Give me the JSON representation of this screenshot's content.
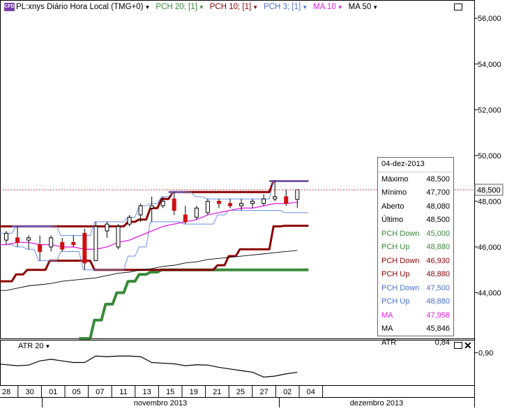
{
  "header": {
    "badge": "CFD",
    "symbol": "PL:xnys Diário Hora Local (TMG+0)",
    "indicators": [
      {
        "label": "PCH 20; [1]",
        "color": "#3a8a3a"
      },
      {
        "label": "PCH 10; [1]",
        "color": "#8b0000"
      },
      {
        "label": "PCH 3; [1]",
        "color": "#4a6fd0"
      },
      {
        "label": "MA 10",
        "color": "#e020e0"
      },
      {
        "label": "MA 50",
        "color": "#000000"
      }
    ]
  },
  "price_axis": {
    "ticks": [
      "56,000",
      "54,000",
      "52,000",
      "50,000",
      "48,000",
      "46,000",
      "44,000"
    ],
    "current_price": "48,500"
  },
  "atr_axis": {
    "ticks": [
      "0,90"
    ]
  },
  "x_axis": {
    "days": [
      "28",
      "30",
      "01",
      "05",
      "07",
      "11",
      "13",
      "15",
      "19",
      "21",
      "25",
      "27",
      "02",
      "04"
    ],
    "months": [
      "novembro 2013",
      "dezembro 2013"
    ]
  },
  "info_box": {
    "date": "04-dez-2013",
    "rows": [
      {
        "label": "Máximo",
        "value": "48,500",
        "color": "#000000"
      },
      {
        "label": "Mínimo",
        "value": "47,700",
        "color": "#000000"
      },
      {
        "label": "Aberto",
        "value": "48,080",
        "color": "#000000"
      },
      {
        "label": "Último",
        "value": "48,500",
        "color": "#000000"
      },
      {
        "label": "PCH Down",
        "value": "45,000",
        "color": "#3a8a3a"
      },
      {
        "label": "PCH Up",
        "value": "48,880",
        "color": "#3a8a3a"
      },
      {
        "label": "PCH Down",
        "value": "46,930",
        "color": "#8b0000"
      },
      {
        "label": "PCH Up",
        "value": "48,880",
        "color": "#8b0000"
      },
      {
        "label": "PCH Down",
        "value": "47,500",
        "color": "#4a6fd0"
      },
      {
        "label": "PCH Up",
        "value": "48,880",
        "color": "#4a6fd0"
      },
      {
        "label": "MA",
        "value": "47,958",
        "color": "#e020e0"
      },
      {
        "label": "MA",
        "value": "45,846",
        "color": "#000000"
      },
      {
        "label": "ATR",
        "value": "0,84",
        "color": "#000000"
      }
    ]
  },
  "atr_panel": {
    "label": "ATR 20"
  },
  "chart_data": {
    "type": "line",
    "title": "PL:xnys Diário Hora Local (TMG+0)",
    "ylim": [
      42.0,
      56.8
    ],
    "atr_ylim": [
      0.8,
      0.94
    ],
    "candles": [
      {
        "o": 46.3,
        "h": 46.7,
        "l": 46.1,
        "c": 46.6
      },
      {
        "o": 46.4,
        "h": 46.9,
        "l": 46.0,
        "c": 46.2
      },
      {
        "o": 46.3,
        "h": 46.5,
        "l": 45.9,
        "c": 46.4
      },
      {
        "o": 46.1,
        "h": 46.5,
        "l": 45.4,
        "c": 45.8
      },
      {
        "o": 46.0,
        "h": 46.5,
        "l": 45.8,
        "c": 46.4
      },
      {
        "o": 46.2,
        "h": 46.4,
        "l": 45.8,
        "c": 45.9
      },
      {
        "o": 46.2,
        "h": 46.5,
        "l": 46.0,
        "c": 46.1
      },
      {
        "o": 46.6,
        "h": 46.8,
        "l": 45.0,
        "c": 45.3
      },
      {
        "o": 45.4,
        "h": 47.1,
        "l": 45.4,
        "c": 46.9
      },
      {
        "o": 46.7,
        "h": 47.1,
        "l": 46.4,
        "c": 47.0
      },
      {
        "o": 46.0,
        "h": 47.0,
        "l": 45.9,
        "c": 46.9
      },
      {
        "o": 47.0,
        "h": 47.4,
        "l": 46.9,
        "c": 47.3
      },
      {
        "o": 47.4,
        "h": 47.9,
        "l": 47.1,
        "c": 47.8
      },
      {
        "o": 47.7,
        "h": 48.2,
        "l": 47.1,
        "c": 47.8
      },
      {
        "o": 47.8,
        "h": 48.2,
        "l": 47.7,
        "c": 48.0
      },
      {
        "o": 48.1,
        "h": 48.4,
        "l": 47.4,
        "c": 47.6
      },
      {
        "o": 47.4,
        "h": 47.8,
        "l": 47.0,
        "c": 47.1
      },
      {
        "o": 47.3,
        "h": 47.8,
        "l": 47.2,
        "c": 47.7
      },
      {
        "o": 47.5,
        "h": 48.1,
        "l": 47.4,
        "c": 48.0
      },
      {
        "o": 48.0,
        "h": 48.1,
        "l": 47.7,
        "c": 47.9
      },
      {
        "o": 47.9,
        "h": 48.1,
        "l": 47.7,
        "c": 47.8
      },
      {
        "o": 47.8,
        "h": 48.1,
        "l": 47.6,
        "c": 47.9
      },
      {
        "o": 47.9,
        "h": 48.1,
        "l": 47.7,
        "c": 48.0
      },
      {
        "o": 47.9,
        "h": 48.3,
        "l": 47.8,
        "c": 48.1
      },
      {
        "o": 48.1,
        "h": 48.9,
        "l": 48.0,
        "c": 48.2
      },
      {
        "o": 48.2,
        "h": 48.5,
        "l": 47.8,
        "c": 47.9
      },
      {
        "o": 48.08,
        "h": 48.5,
        "l": 47.7,
        "c": 48.5
      }
    ],
    "series": [
      {
        "name": "PCH 20 Down",
        "color": "#3a8a3a",
        "values": [
          null,
          null,
          null,
          null,
          null,
          null,
          null,
          42.0,
          42.8,
          43.5,
          44.0,
          44.5,
          44.8,
          44.9,
          45.0,
          45.0,
          45.0,
          45.0,
          45.0,
          45.0,
          45.0,
          45.0,
          45.0,
          45.0,
          45.0,
          45.0,
          45.0
        ]
      },
      {
        "name": "PCH 10 Up",
        "color": "#8b0000",
        "values": [
          46.9,
          46.9,
          46.9,
          46.9,
          46.9,
          46.9,
          46.9,
          46.9,
          46.9,
          46.9,
          46.9,
          47.1,
          47.2,
          47.7,
          48.1,
          48.4,
          48.4,
          48.4,
          48.4,
          48.4,
          48.4,
          48.4,
          48.4,
          48.4,
          48.88,
          48.88,
          48.88
        ]
      },
      {
        "name": "PCH 10 Down",
        "color": "#8b0000",
        "values": [
          44.5,
          44.8,
          45.0,
          45.0,
          45.4,
          45.4,
          45.4,
          45.4,
          45.0,
          45.0,
          45.0,
          45.0,
          45.0,
          45.0,
          45.0,
          45.0,
          45.0,
          45.0,
          45.0,
          45.2,
          45.6,
          45.9,
          45.9,
          45.9,
          46.9,
          46.93,
          46.93
        ]
      },
      {
        "name": "PCH 3 Up",
        "color": "#4a6fd0",
        "values": [
          46.6,
          46.9,
          46.9,
          46.9,
          46.9,
          46.5,
          46.5,
          46.5,
          47.1,
          47.1,
          47.1,
          47.3,
          47.8,
          47.9,
          48.2,
          48.4,
          48.4,
          48.2,
          48.1,
          48.1,
          48.1,
          48.1,
          48.1,
          48.1,
          48.88,
          48.88,
          48.88
        ]
      },
      {
        "name": "PCH 3 Down",
        "color": "#4a6fd0",
        "values": [
          46.1,
          46.0,
          45.9,
          45.4,
          45.4,
          45.8,
          45.8,
          45.0,
          45.0,
          45.0,
          45.0,
          45.6,
          46.0,
          47.1,
          47.1,
          47.1,
          47.0,
          47.0,
          47.0,
          47.4,
          47.6,
          47.6,
          47.6,
          47.6,
          47.6,
          47.5,
          47.5
        ]
      },
      {
        "name": "MA 10",
        "color": "#e020e0",
        "values": [
          46.1,
          46.2,
          46.2,
          46.1,
          46.1,
          46.0,
          46.0,
          45.9,
          45.9,
          46.0,
          46.2,
          46.3,
          46.5,
          46.7,
          46.9,
          47.0,
          47.1,
          47.2,
          47.4,
          47.5,
          47.6,
          47.7,
          47.7,
          47.8,
          47.9,
          47.9,
          47.958
        ]
      },
      {
        "name": "MA 50",
        "color": "#000000",
        "values": [
          44.1,
          44.2,
          44.3,
          44.35,
          44.4,
          44.5,
          44.55,
          44.6,
          44.65,
          44.75,
          44.85,
          44.9,
          45.0,
          45.05,
          45.15,
          45.2,
          45.3,
          45.35,
          45.45,
          45.5,
          45.55,
          45.6,
          45.65,
          45.7,
          45.75,
          45.8,
          45.846
        ]
      },
      {
        "name": "ATR 20",
        "color": "#000000",
        "values": [
          0.865,
          0.86,
          0.862,
          0.875,
          0.88,
          0.875,
          0.87,
          0.87,
          0.89,
          0.888,
          0.89,
          0.89,
          0.888,
          0.87,
          0.868,
          0.866,
          0.86,
          0.863,
          0.862,
          0.855,
          0.85,
          0.845,
          0.84,
          0.825,
          0.828,
          0.835,
          0.84
        ]
      }
    ]
  }
}
